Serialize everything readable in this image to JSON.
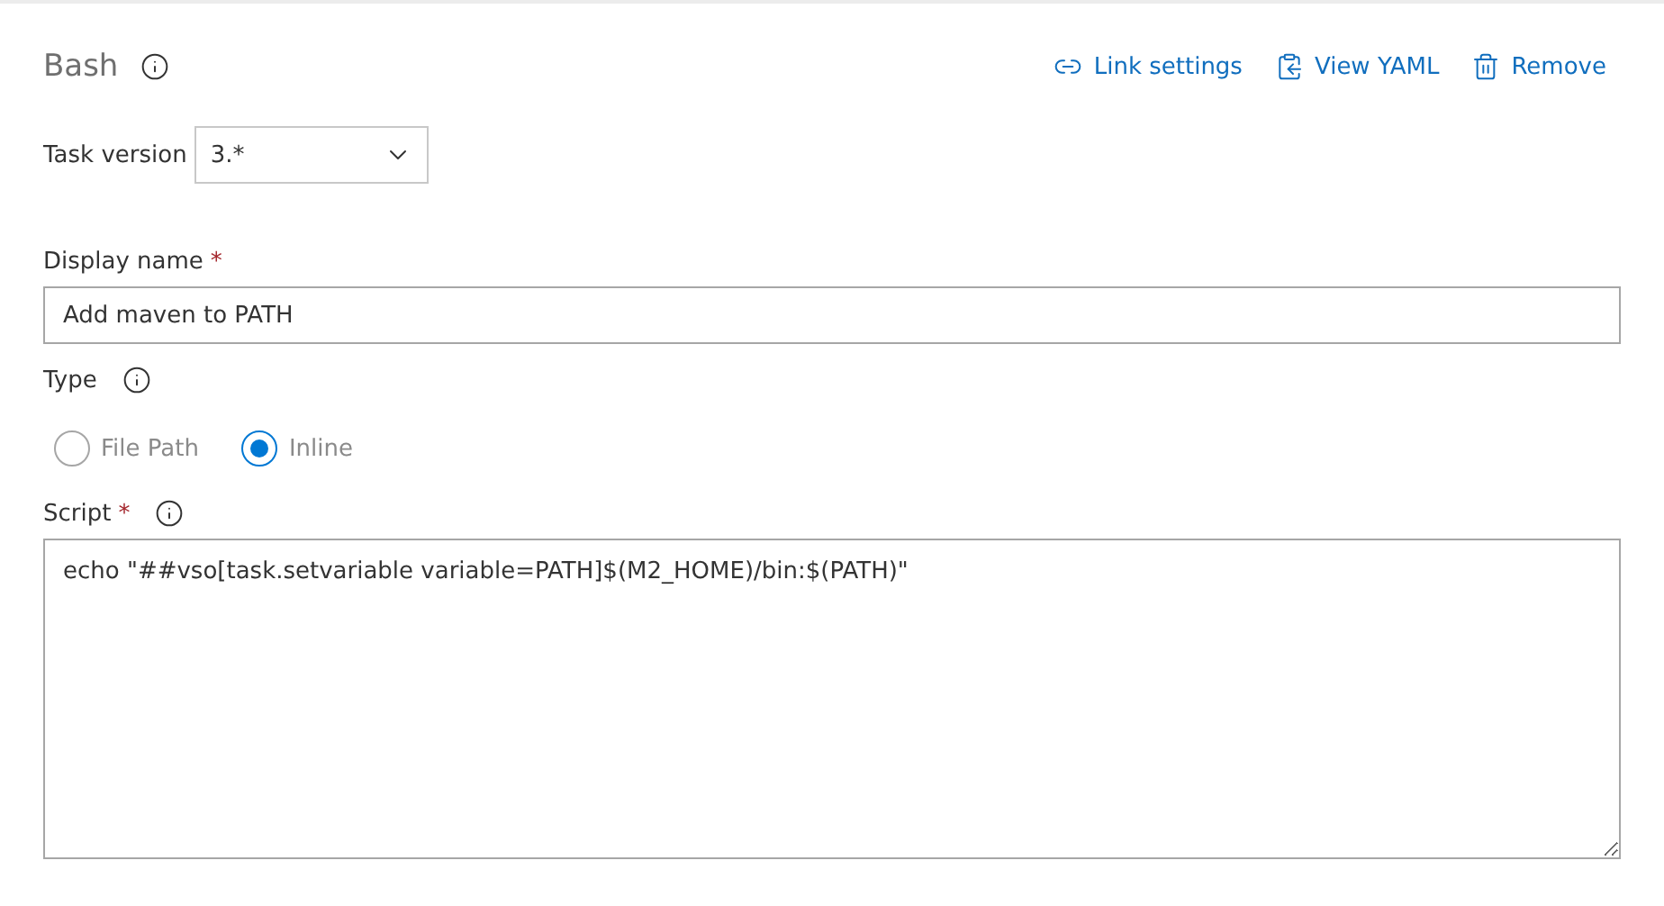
{
  "title": "Bash",
  "actions": [
    {
      "kind": "link",
      "label": "Link settings"
    },
    {
      "kind": "yaml",
      "label": "View YAML"
    },
    {
      "kind": "remove",
      "label": "Remove"
    }
  ],
  "task_version": {
    "label": "Task version",
    "value": "3.*"
  },
  "display_name": {
    "label": "Display name",
    "required_mark": "*",
    "value": "Add maven to PATH"
  },
  "type": {
    "label": "Type",
    "options": [
      {
        "label": "File Path",
        "selected": false
      },
      {
        "label": "Inline",
        "selected": true
      }
    ]
  },
  "script": {
    "label": "Script",
    "required_mark": "*",
    "value": "echo \"##vso[task.setvariable variable=PATH]$(M2_HOME)/bin:$(PATH)\""
  }
}
